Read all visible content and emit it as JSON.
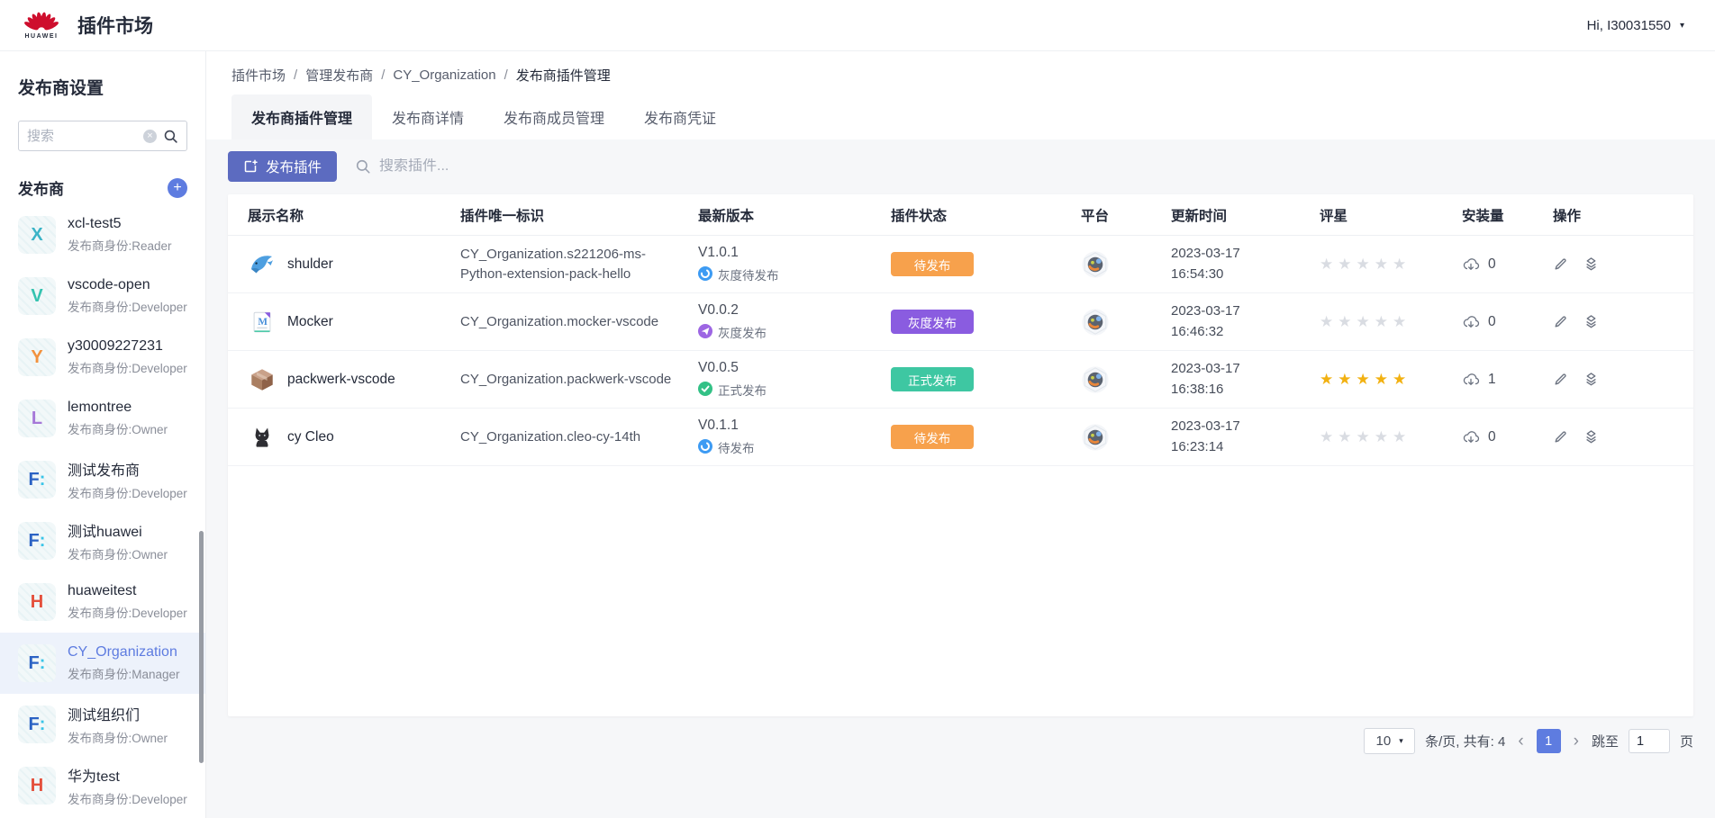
{
  "navbar": {
    "brand": "HUAWEI",
    "title": "插件市场",
    "user": "Hi, I30031550"
  },
  "icons": {
    "plus": "+",
    "caret_down": "▾",
    "chevron_left": "‹",
    "chevron_right": "›",
    "star": "★",
    "clear": "×",
    "breadcrumb_separator": "/"
  },
  "sidebar": {
    "title": "发布商设置",
    "search_placeholder": "搜索",
    "section_title": "发布商",
    "publishers": [
      {
        "name": "xcl-test5",
        "role": "发布商身份:Reader",
        "glyph": "X",
        "glyph2": "",
        "color": "#3bb4c7",
        "selected": false
      },
      {
        "name": "vscode-open",
        "role": "发布商身份:Developer",
        "glyph": "V",
        "glyph2": "",
        "color": "#35c3b0",
        "selected": false
      },
      {
        "name": "y30009227231",
        "role": "发布商身份:Developer",
        "glyph": "Y",
        "glyph2": "",
        "color": "#f2913d",
        "selected": false
      },
      {
        "name": "lemontree",
        "role": "发布商身份:Owner",
        "glyph": "L",
        "glyph2": "",
        "color": "#a678d8",
        "selected": false
      },
      {
        "name": "测试发布商",
        "role": "发布商身份:Developer",
        "glyph": "F",
        "glyph2": ":",
        "color": "#2b62c4",
        "selected": false
      },
      {
        "name": "测试huawei",
        "role": "发布商身份:Owner",
        "glyph": "F",
        "glyph2": ":",
        "color": "#2b62c4",
        "selected": false
      },
      {
        "name": "huaweitest",
        "role": "发布商身份:Developer",
        "glyph": "H",
        "glyph2": "",
        "color": "#e4503c",
        "selected": false
      },
      {
        "name": "CY_Organization",
        "role": "发布商身份:Manager",
        "glyph": "F",
        "glyph2": ":",
        "color": "#2b62c4",
        "selected": true
      },
      {
        "name": "测试组织们",
        "role": "发布商身份:Owner",
        "glyph": "F",
        "glyph2": ":",
        "color": "#2b62c4",
        "selected": false
      },
      {
        "name": "华为test",
        "role": "发布商身份:Developer",
        "glyph": "H",
        "glyph2": "",
        "color": "#e4503c",
        "selected": false
      }
    ]
  },
  "breadcrumb": [
    "插件市场",
    "管理发布商",
    "CY_Organization",
    "发布商插件管理"
  ],
  "tabs": [
    {
      "label": "发布商插件管理",
      "active": true
    },
    {
      "label": "发布商详情",
      "active": false
    },
    {
      "label": "发布商成员管理",
      "active": false
    },
    {
      "label": "发布商凭证",
      "active": false
    }
  ],
  "toolbar": {
    "publish_button": "发布插件",
    "search_placeholder": "搜索插件..."
  },
  "table": {
    "columns": [
      "展示名称",
      "插件唯一标识",
      "最新版本",
      "插件状态",
      "平台",
      "更新时间",
      "评星",
      "安装量",
      "操作"
    ],
    "rows": [
      {
        "name": "shulder",
        "icon": "dolphin",
        "id": "CY_Organization.s221206-ms-Python-extension-pack-hello",
        "version": "V1.0.1",
        "version_status": "灰度待发布",
        "version_icon": "pending-blue",
        "status": "待发布",
        "status_color": "#f7a14c",
        "updated_date": "2023-03-17",
        "updated_time": "16:54:30",
        "stars": 0,
        "installs": "0"
      },
      {
        "name": "Mocker",
        "icon": "doc-m",
        "id": "CY_Organization.mocker-vscode",
        "version": "V0.0.2",
        "version_status": "灰度发布",
        "version_icon": "gray-purple",
        "status": "灰度发布",
        "status_color": "#8a5ce0",
        "updated_date": "2023-03-17",
        "updated_time": "16:46:32",
        "stars": 0,
        "installs": "0"
      },
      {
        "name": "packwerk-vscode",
        "icon": "package",
        "id": "CY_Organization.packwerk-vscode",
        "version": "V0.0.5",
        "version_status": "正式发布",
        "version_icon": "official-green",
        "status": "正式发布",
        "status_color": "#3ec7a2",
        "updated_date": "2023-03-17",
        "updated_time": "16:38:16",
        "stars": 5,
        "installs": "1"
      },
      {
        "name": "cy Cleo",
        "icon": "cat",
        "id": "CY_Organization.cleo-cy-14th",
        "version": "V0.1.1",
        "version_status": "待发布",
        "version_icon": "pending-blue",
        "status": "待发布",
        "status_color": "#f7a14c",
        "updated_date": "2023-03-17",
        "updated_time": "16:23:14",
        "stars": 0,
        "installs": "0"
      }
    ]
  },
  "pagination": {
    "page_size": "10",
    "summary": "条/页, 共有: 4",
    "current_page": "1",
    "jump_prefix": "跳至",
    "jump_value": "1",
    "jump_suffix": "页"
  }
}
